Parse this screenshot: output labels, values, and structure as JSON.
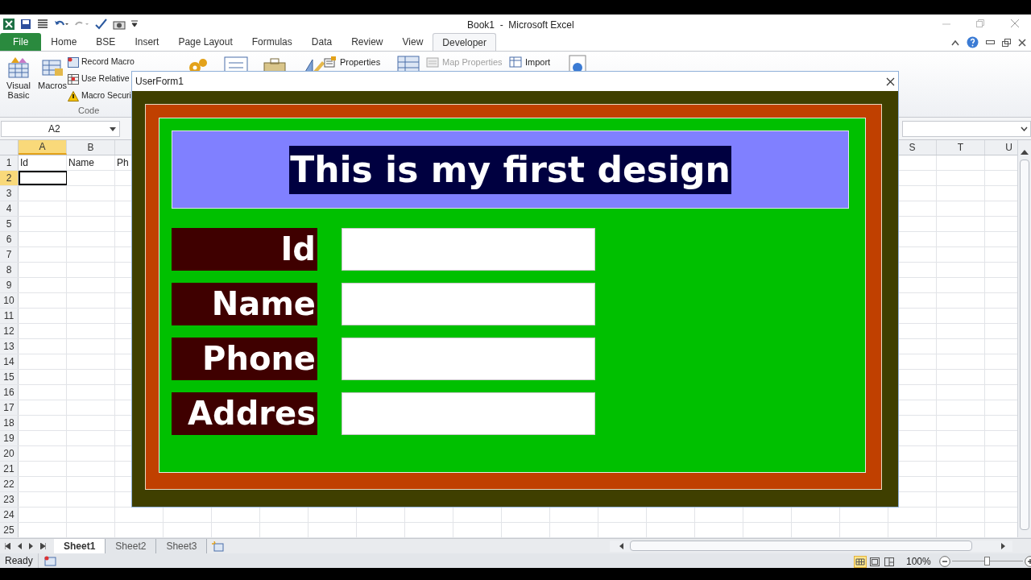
{
  "window": {
    "title": "Book1  -  Microsoft Excel"
  },
  "ribbon_tabs": [
    {
      "label": "File",
      "kind": "file",
      "selected": false
    },
    {
      "label": "Home",
      "kind": "tab",
      "selected": false
    },
    {
      "label": "BSE",
      "kind": "tab",
      "selected": false
    },
    {
      "label": "Insert",
      "kind": "tab",
      "selected": false
    },
    {
      "label": "Page Layout",
      "kind": "tab",
      "selected": false
    },
    {
      "label": "Formulas",
      "kind": "tab",
      "selected": false
    },
    {
      "label": "Data",
      "kind": "tab",
      "selected": false
    },
    {
      "label": "Review",
      "kind": "tab",
      "selected": false
    },
    {
      "label": "View",
      "kind": "tab",
      "selected": false
    },
    {
      "label": "Developer",
      "kind": "tab",
      "selected": true
    }
  ],
  "code_group": {
    "label": "Code",
    "large": [
      "Visual Basic",
      "Macros"
    ],
    "small": [
      "Record Macro",
      "Use Relative",
      "Macro Securi"
    ]
  },
  "ribbon_small": [
    {
      "label": "Properties",
      "disabled": false
    },
    {
      "label": "Map Properties",
      "disabled": true
    },
    {
      "label": "Import",
      "disabled": false
    }
  ],
  "name_box": "A2",
  "columns": [
    {
      "label": "A",
      "selected": true
    },
    {
      "label": "B",
      "selected": false
    },
    {
      "label": "S",
      "selected": false
    },
    {
      "label": "T",
      "selected": false
    },
    {
      "label": "U",
      "selected": false
    }
  ],
  "rows": [
    {
      "label": "1",
      "selected": false,
      "cells": [
        "Id",
        "Name",
        "Ph"
      ]
    },
    {
      "label": "2",
      "selected": true,
      "cells": []
    },
    {
      "label": "3",
      "selected": false,
      "cells": []
    },
    {
      "label": "4",
      "selected": false,
      "cells": []
    },
    {
      "label": "5",
      "selected": false,
      "cells": []
    },
    {
      "label": "6",
      "selected": false,
      "cells": []
    },
    {
      "label": "7",
      "selected": false,
      "cells": []
    },
    {
      "label": "8",
      "selected": false,
      "cells": []
    },
    {
      "label": "9",
      "selected": false,
      "cells": []
    },
    {
      "label": "10",
      "selected": false,
      "cells": []
    },
    {
      "label": "11",
      "selected": false,
      "cells": []
    },
    {
      "label": "12",
      "selected": false,
      "cells": []
    },
    {
      "label": "13",
      "selected": false,
      "cells": []
    },
    {
      "label": "14",
      "selected": false,
      "cells": []
    },
    {
      "label": "15",
      "selected": false,
      "cells": []
    },
    {
      "label": "16",
      "selected": false,
      "cells": []
    },
    {
      "label": "17",
      "selected": false,
      "cells": []
    },
    {
      "label": "18",
      "selected": false,
      "cells": []
    },
    {
      "label": "19",
      "selected": false,
      "cells": []
    },
    {
      "label": "20",
      "selected": false,
      "cells": []
    },
    {
      "label": "21",
      "selected": false,
      "cells": []
    },
    {
      "label": "22",
      "selected": false,
      "cells": []
    },
    {
      "label": "23",
      "selected": false,
      "cells": []
    },
    {
      "label": "24",
      "selected": false,
      "cells": []
    },
    {
      "label": "25",
      "selected": false,
      "cells": []
    }
  ],
  "sheet_tabs": [
    {
      "label": "Sheet1",
      "selected": true
    },
    {
      "label": "Sheet2",
      "selected": false
    },
    {
      "label": "Sheet3",
      "selected": false
    }
  ],
  "status_bar": {
    "text": "Ready",
    "zoom": "100%",
    "zoom_level": {
      "level": 0.5
    }
  },
  "userform": {
    "title": "UserForm1",
    "heading": "This is my first design",
    "fields": [
      {
        "label": "Id"
      },
      {
        "label": "Name"
      },
      {
        "label": "Phone"
      },
      {
        "label": "Addres"
      }
    ]
  }
}
